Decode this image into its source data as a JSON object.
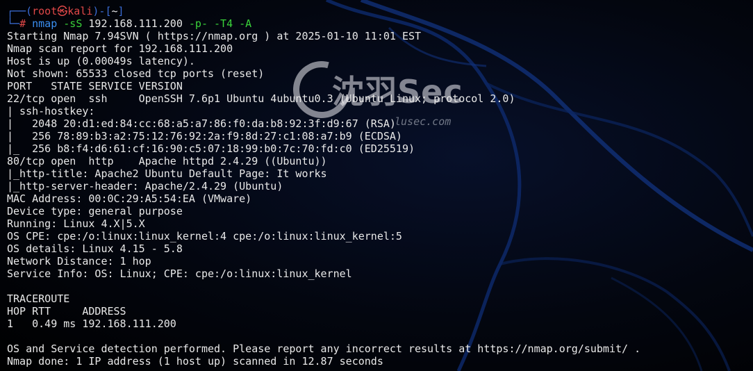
{
  "prompt": {
    "frame_top_left": "┌──(",
    "user": "root",
    "skull": "㉿",
    "host": "kali",
    "frame_mid": ")-[",
    "cwd": "~",
    "frame_close": "]",
    "frame_bottom_left": "└─",
    "hash": "#"
  },
  "command": {
    "program": "nmap",
    "arg1": "-sS",
    "target": "192.168.111.200",
    "arg2": "-p-",
    "arg3": "-T4",
    "arg4": "-A"
  },
  "output_lines": [
    "Starting Nmap 7.94SVN ( https://nmap.org ) at 2025-01-10 11:01 EST",
    "Nmap scan report for 192.168.111.200",
    "Host is up (0.00049s latency).",
    "Not shown: 65533 closed tcp ports (reset)",
    "PORT   STATE SERVICE VERSION",
    "22/tcp open  ssh     OpenSSH 7.6p1 Ubuntu 4ubuntu0.3 (Ubuntu Linux; protocol 2.0)",
    "| ssh-hostkey: ",
    "|   2048 20:d1:ed:84:cc:68:a5:a7:86:f0:da:b8:92:3f:d9:67 (RSA)",
    "|   256 78:89:b3:a2:75:12:76:92:2a:f9:8d:27:c1:08:a7:b9 (ECDSA)",
    "|_  256 b8:f4:d6:61:cf:16:90:c5:07:18:99:b0:7c:70:fd:c0 (ED25519)",
    "80/tcp open  http    Apache httpd 2.4.29 ((Ubuntu))",
    "|_http-title: Apache2 Ubuntu Default Page: It works",
    "|_http-server-header: Apache/2.4.29 (Ubuntu)",
    "MAC Address: 00:0C:29:A5:54:EA (VMware)",
    "Device type: general purpose",
    "Running: Linux 4.X|5.X",
    "OS CPE: cpe:/o:linux:linux_kernel:4 cpe:/o:linux:linux_kernel:5",
    "OS details: Linux 4.15 - 5.8",
    "Network Distance: 1 hop",
    "Service Info: OS: Linux; CPE: cpe:/o:linux:linux_kernel",
    "",
    "TRACEROUTE",
    "HOP RTT     ADDRESS",
    "1   0.49 ms 192.168.111.200",
    "",
    "OS and Service detection performed. Please report any incorrect results at https://nmap.org/submit/ .",
    "Nmap done: 1 IP address (1 host up) scanned in 12.87 seconds"
  ],
  "watermark": {
    "title": "沈羽Sec",
    "url": "lusec.com"
  },
  "colors": {
    "background": "#000000",
    "text": "#e9e9e9",
    "prompt_frame": "#3b6dd6",
    "prompt_user": "#e04848",
    "command": "#3b8ef0",
    "flags": "#3ad23a"
  }
}
